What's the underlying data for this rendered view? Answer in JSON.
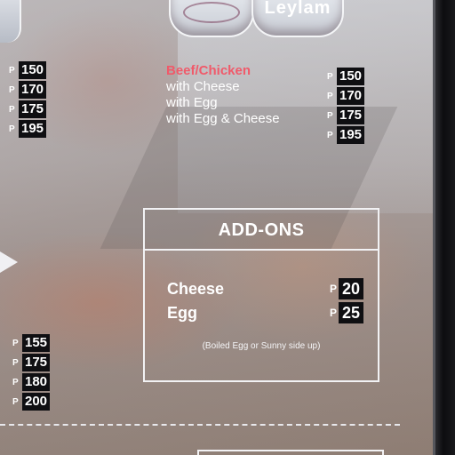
{
  "cups": {
    "right_brand": "Leylam"
  },
  "top_left_prices": [
    {
      "currency": "P",
      "price": "150"
    },
    {
      "currency": "P",
      "price": "170"
    },
    {
      "currency": "P",
      "price": "175"
    },
    {
      "currency": "P",
      "price": "195"
    }
  ],
  "menu_item": {
    "title": "Beef/Chicken",
    "variants": [
      "with Cheese",
      "with Egg",
      "with Egg & Cheese"
    ],
    "prices": [
      {
        "currency": "P",
        "price": "150"
      },
      {
        "currency": "P",
        "price": "170"
      },
      {
        "currency": "P",
        "price": "175"
      },
      {
        "currency": "P",
        "price": "195"
      }
    ]
  },
  "addons": {
    "heading": "ADD-ONS",
    "items": [
      {
        "name": "Cheese",
        "currency": "P",
        "price": "20"
      },
      {
        "name": "Egg",
        "currency": "P",
        "price": "25"
      }
    ],
    "note": "(Boiled Egg or Sunny side up)"
  },
  "bottom_left_prices": [
    {
      "currency": "P",
      "price": "155"
    },
    {
      "currency": "P",
      "price": "175"
    },
    {
      "currency": "P",
      "price": "180"
    },
    {
      "currency": "P",
      "price": "200"
    }
  ],
  "colors": {
    "accent": "#f05a6a",
    "tag_bg": "#0f0f12",
    "text": "#ffffff"
  }
}
